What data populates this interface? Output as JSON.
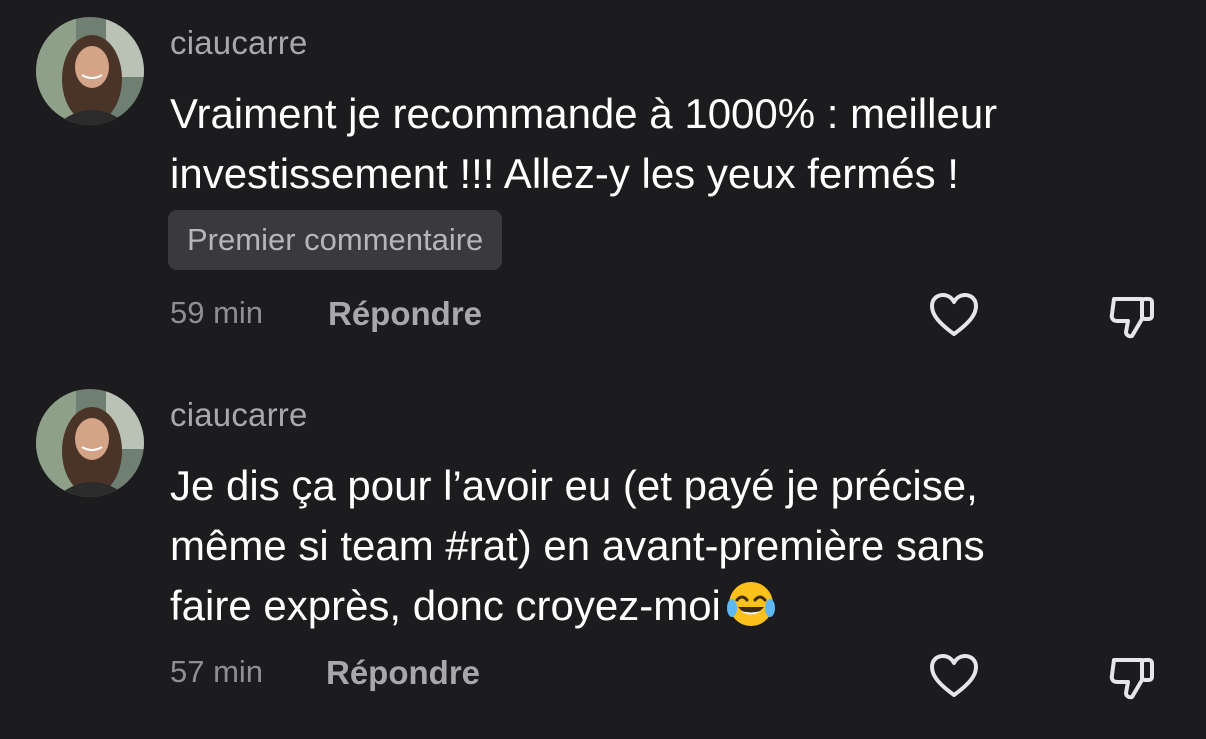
{
  "comments": [
    {
      "username": "ciaucarre",
      "text": "Vraiment je recommande à 1000% : meilleur\ninvestissement !!! Allez-y les yeux fermés !",
      "badge": "Premier commentaire",
      "time": "59 min",
      "reply_label": "Répondre",
      "like_icon": "heart-outline-icon",
      "dislike_icon": "thumbs-down-outline-icon"
    },
    {
      "username": "ciaucarre",
      "text": "Je dis ça pour l’avoir eu (et payé je précise,\nmême si team #rat) en avant-première sans\nfaire exprès, donc croyez-moi",
      "emoji": "😂",
      "time": "57 min",
      "reply_label": "Répondre",
      "like_icon": "heart-outline-icon",
      "dislike_icon": "thumbs-down-outline-icon"
    }
  ],
  "colors": {
    "background": "#1c1c1e",
    "text": "#ffffff",
    "muted": "#a8a8ac",
    "badge_bg": "#3a3a3c"
  }
}
